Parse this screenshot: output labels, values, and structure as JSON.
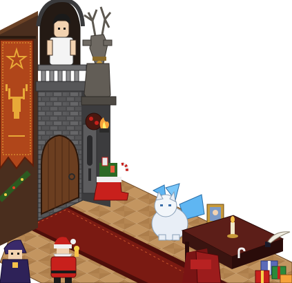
{
  "scene": {
    "type": "isometric pixel-art game room",
    "palette": {
      "background": "#ffffff",
      "stone_dark": "#3c3c3e",
      "stone_mid": "#5a5a5c",
      "stone_light": "#7a7a7c",
      "wood_wall": "#4a2e1e",
      "wood_beam": "#6b4226",
      "floor_tan": "#b98a55",
      "floor_light": "#d2a56c",
      "floor_dark": "#8a6238",
      "carpet_red": "#7a1a12",
      "carpet_border": "#4e0e0a",
      "banner_red": "#b0461a",
      "banner_gold": "#e8a938",
      "door_wood": "#6b3e20",
      "desk_dark": "#3a1410",
      "desk_top": "#5c1e18",
      "armchair_red": "#9c1c1c",
      "stag_grey": "#6f6a63",
      "cat_white": "#e8eef6",
      "wing_blue": "#5fb6f2",
      "fire_orange": "#f6a23a",
      "santa_red": "#c8201c"
    }
  },
  "objects": [
    {
      "name": "castle-wall",
      "label": ""
    },
    {
      "name": "hanging-banner-stag",
      "label": ""
    },
    {
      "name": "balcony-avatar",
      "label": ""
    },
    {
      "name": "stag-statue",
      "label": ""
    },
    {
      "name": "wall-torch",
      "label": ""
    },
    {
      "name": "arched-door",
      "label": ""
    },
    {
      "name": "christmas-boot",
      "label": ""
    },
    {
      "name": "winged-white-cat",
      "label": ""
    },
    {
      "name": "writing-desk",
      "label": ""
    },
    {
      "name": "red-armchair",
      "label": ""
    },
    {
      "name": "gift-boxes",
      "label": ""
    },
    {
      "name": "santa-avatar",
      "label": ""
    },
    {
      "name": "wizard-avatar",
      "label": ""
    }
  ]
}
